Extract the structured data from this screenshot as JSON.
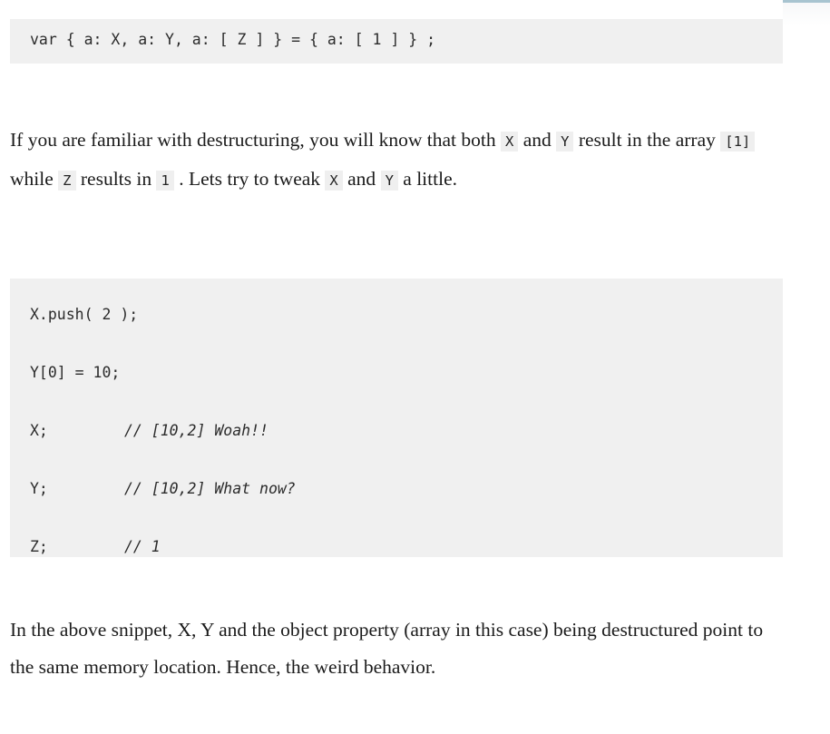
{
  "page": {
    "background_color": "#ffffff",
    "top_rule_color": "#a8c4d0",
    "code_background_color": "#f0f0f0",
    "inline_code_background_color": "#efefef",
    "text_color": "#1b1b1b"
  },
  "code_block_1": {
    "language": "javascript",
    "lines": [
      "var { a: X, a: Y, a: [ Z ] } = { a: [ 1 ] } ;"
    ]
  },
  "paragraph_1": {
    "segments": [
      {
        "type": "text",
        "value": "If you are familiar with destructuring, you will know that both "
      },
      {
        "type": "code",
        "value": "X"
      },
      {
        "type": "text",
        "value": " and "
      },
      {
        "type": "code",
        "value": "Y"
      },
      {
        "type": "text",
        "value": " result in the array "
      },
      {
        "type": "code",
        "value": "[1]"
      },
      {
        "type": "text",
        "value": " while "
      },
      {
        "type": "code",
        "value": "Z"
      },
      {
        "type": "text",
        "value": " results in "
      },
      {
        "type": "code",
        "value": "1"
      },
      {
        "type": "text",
        "value": " . Lets try to tweak "
      },
      {
        "type": "code",
        "value": "X"
      },
      {
        "type": "text",
        "value": " and "
      },
      {
        "type": "code",
        "value": "Y"
      },
      {
        "type": "text",
        "value": " a little."
      }
    ],
    "t0": "If you are familiar with destructuring, you will know that both ",
    "c0": "X",
    "t1": " and ",
    "c1": "Y",
    "t2": " result in the array ",
    "c2": "[1]",
    "t3": " while ",
    "c3": "Z",
    "t4": " results in ",
    "c4": "1",
    "t5": " . Lets try to tweak ",
    "c5": "X",
    "t6": " and ",
    "c6": "Y",
    "t7": " a little."
  },
  "code_block_2": {
    "language": "javascript",
    "lines": [
      {
        "code": "X.push( 2 );",
        "comment": ""
      },
      {
        "code": "Y[0] = 10;",
        "comment": ""
      },
      {
        "code": "X;",
        "comment": "// [10,2] Woah!!"
      },
      {
        "code": "Y;",
        "comment": "// [10,2] What now?"
      },
      {
        "code": "Z;",
        "comment": "// 1"
      }
    ]
  },
  "paragraph_2": {
    "text": "In the above snippet, X, Y and the object property (array in this case) being destructured point to the same memory location. Hence, the weird behavior."
  }
}
